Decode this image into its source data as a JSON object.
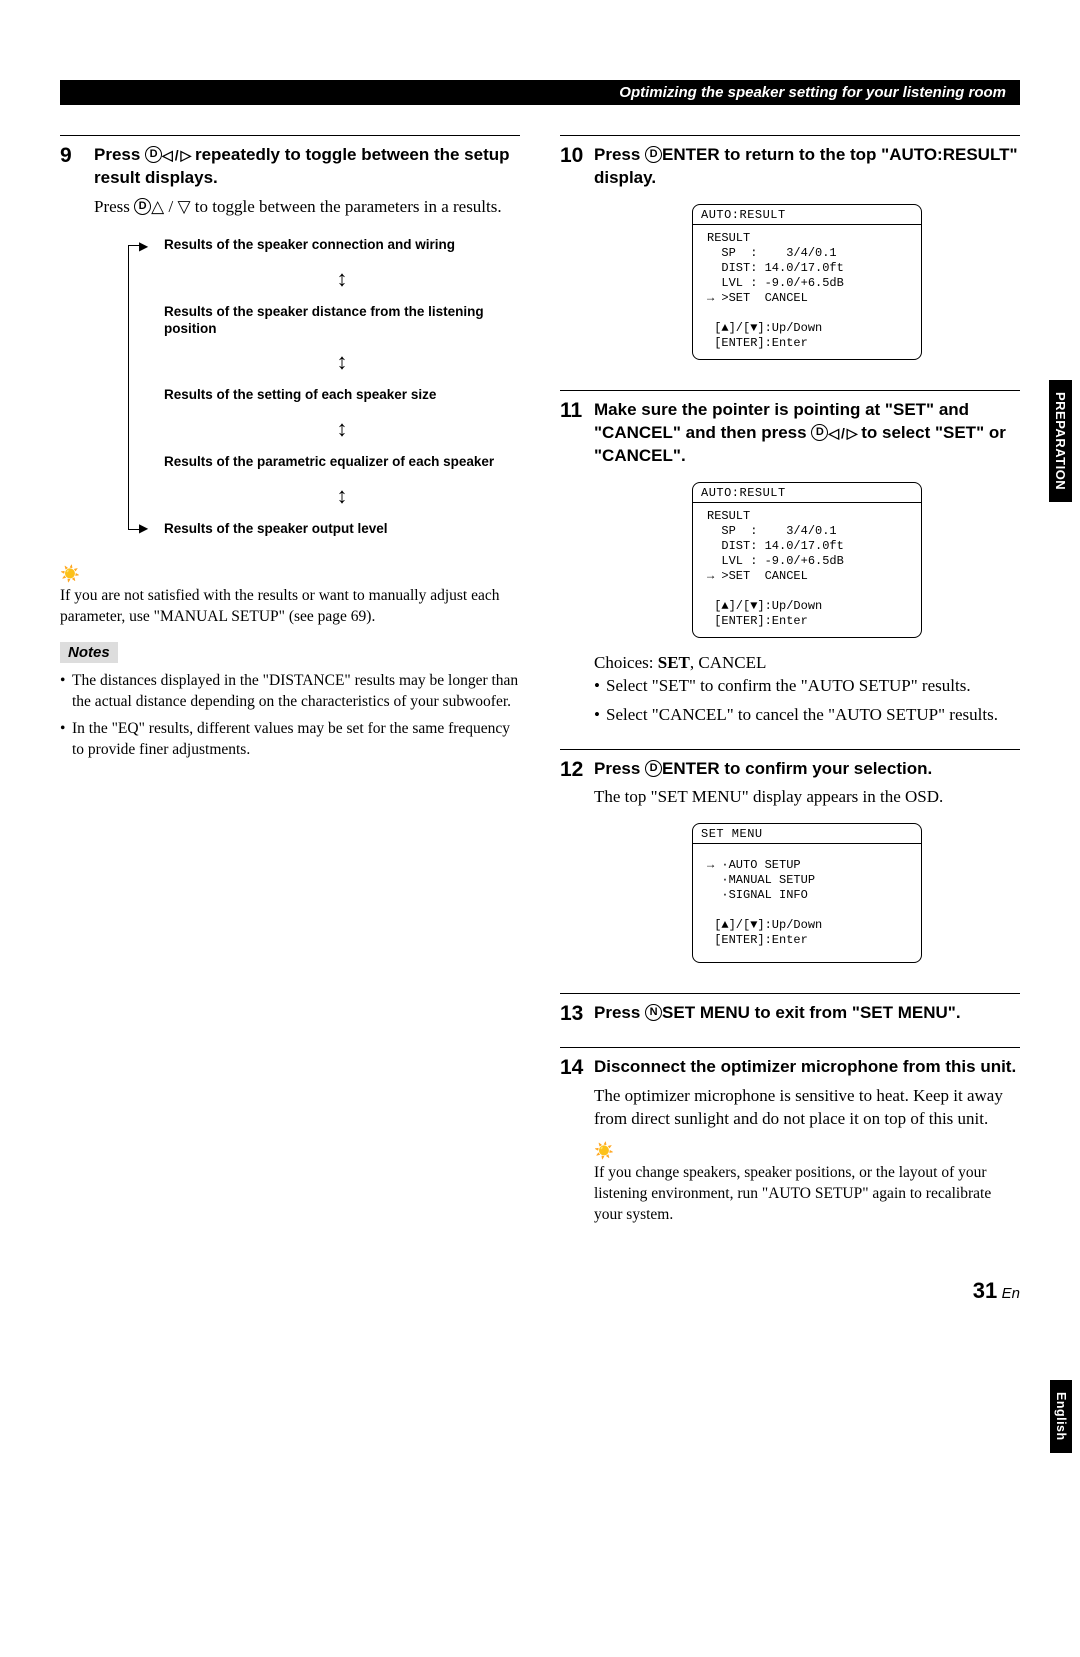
{
  "header": {
    "title": "Optimizing the speaker setting for your listening room"
  },
  "side_tabs": {
    "preparation": "PREPARATION",
    "english": "English"
  },
  "page": {
    "number": "31",
    "lang": "En"
  },
  "step9": {
    "num": "9",
    "title_pre": "Press ",
    "title_button": "D",
    "title_mid": " repeatedly to toggle between the setup result displays.",
    "body_pre": "Press ",
    "body_button": "D",
    "body_post": " to toggle between the parameters in a results.",
    "diagram": {
      "r1": "Results of the speaker connection and wiring",
      "r2": "Results of the speaker distance from the listening position",
      "r3": "Results of the setting of each speaker size",
      "r4": "Results of the parametric equalizer of each speaker",
      "r5": "Results of the speaker output level"
    },
    "tip": "If you are not satisfied with the results or want to manually adjust each parameter, use \"MANUAL SETUP\" (see page 69).",
    "notes_label": "Notes",
    "note1": "The distances displayed in the \"DISTANCE\" results may be longer than the actual distance depending on the characteristics of your subwoofer.",
    "note2": "In the \"EQ\" results, different values may be set for the same frequency to provide finer adjustments."
  },
  "step10": {
    "num": "10",
    "title_pre": "Press ",
    "title_button": "D",
    "title_enter": "ENTER",
    "title_post": " to return to the top \"AUTO:RESULT\" display."
  },
  "step11": {
    "num": "11",
    "title_pre": "Make sure the pointer is pointing at \"SET\" and \"CANCEL\" and then press ",
    "title_button": "D",
    "title_post": " to select \"SET\" or \"CANCEL\".",
    "choices_pre": "Choices: ",
    "choices_bold": "SET",
    "choices_rest": ", CANCEL",
    "c1": "Select \"SET\" to confirm the \"AUTO SETUP\" results.",
    "c2": "Select \"CANCEL\" to cancel the \"AUTO SETUP\" results."
  },
  "step12": {
    "num": "12",
    "title_pre": "Press ",
    "title_button": "D",
    "title_enter": "ENTER",
    "title_post": " to confirm your selection.",
    "body": "The top \"SET MENU\" display appears in the OSD."
  },
  "step13": {
    "num": "13",
    "title_pre": "Press ",
    "title_button": "N",
    "title_menu": "SET MENU",
    "title_post": " to exit from \"SET MENU\"."
  },
  "step14": {
    "num": "14",
    "title": "Disconnect the optimizer microphone from this unit.",
    "body": "The optimizer microphone is sensitive to heat. Keep it away from direct sunlight and do not place it on top of this unit.",
    "tip": "If you change speakers, speaker positions, or the layout of your listening environment, run \"AUTO SETUP\" again to recalibrate your system."
  },
  "osd_result": {
    "title": "AUTO:RESULT",
    "l1": "RESULT",
    "l2": "  SP  :    3/4/0.1",
    "l3": "  DIST: 14.0/17.0ft",
    "l4": "  LVL : -9.0/+6.5dB",
    "l5": "→ >SET  CANCEL",
    "l6": " [▲]/[▼]:Up/Down",
    "l7": " [ENTER]:Enter"
  },
  "osd_menu": {
    "title": "SET MENU",
    "l1": "→ ·AUTO SETUP",
    "l2": "  ·MANUAL SETUP",
    "l3": "  ·SIGNAL INFO",
    "l4": " [▲]/[▼]:Up/Down",
    "l5": " [ENTER]:Enter"
  }
}
